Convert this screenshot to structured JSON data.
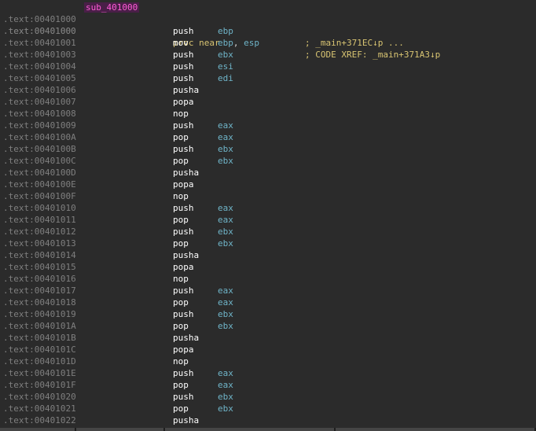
{
  "header": {
    "row1": {
      "address": ".text:00401000",
      "label": "sub_401000",
      "proc": "proc near",
      "comment": "; CODE XREF: _main+371A3↓p"
    },
    "row2": {
      "address": ".text:00401000",
      "comment": "; _main+371EC↓p ..."
    }
  },
  "instructions": [
    {
      "addr": ".text:00401000",
      "mnem": "push",
      "ops": [
        "ebp"
      ]
    },
    {
      "addr": ".text:00401001",
      "mnem": "mov",
      "ops": [
        "ebp",
        "esp"
      ]
    },
    {
      "addr": ".text:00401003",
      "mnem": "push",
      "ops": [
        "ebx"
      ]
    },
    {
      "addr": ".text:00401004",
      "mnem": "push",
      "ops": [
        "esi"
      ]
    },
    {
      "addr": ".text:00401005",
      "mnem": "push",
      "ops": [
        "edi"
      ]
    },
    {
      "addr": ".text:00401006",
      "mnem": "pusha",
      "ops": []
    },
    {
      "addr": ".text:00401007",
      "mnem": "popa",
      "ops": []
    },
    {
      "addr": ".text:00401008",
      "mnem": "nop",
      "ops": []
    },
    {
      "addr": ".text:00401009",
      "mnem": "push",
      "ops": [
        "eax"
      ]
    },
    {
      "addr": ".text:0040100A",
      "mnem": "pop",
      "ops": [
        "eax"
      ]
    },
    {
      "addr": ".text:0040100B",
      "mnem": "push",
      "ops": [
        "ebx"
      ]
    },
    {
      "addr": ".text:0040100C",
      "mnem": "pop",
      "ops": [
        "ebx"
      ]
    },
    {
      "addr": ".text:0040100D",
      "mnem": "pusha",
      "ops": []
    },
    {
      "addr": ".text:0040100E",
      "mnem": "popa",
      "ops": []
    },
    {
      "addr": ".text:0040100F",
      "mnem": "nop",
      "ops": []
    },
    {
      "addr": ".text:00401010",
      "mnem": "push",
      "ops": [
        "eax"
      ]
    },
    {
      "addr": ".text:00401011",
      "mnem": "pop",
      "ops": [
        "eax"
      ]
    },
    {
      "addr": ".text:00401012",
      "mnem": "push",
      "ops": [
        "ebx"
      ]
    },
    {
      "addr": ".text:00401013",
      "mnem": "pop",
      "ops": [
        "ebx"
      ]
    },
    {
      "addr": ".text:00401014",
      "mnem": "pusha",
      "ops": []
    },
    {
      "addr": ".text:00401015",
      "mnem": "popa",
      "ops": []
    },
    {
      "addr": ".text:00401016",
      "mnem": "nop",
      "ops": []
    },
    {
      "addr": ".text:00401017",
      "mnem": "push",
      "ops": [
        "eax"
      ]
    },
    {
      "addr": ".text:00401018",
      "mnem": "pop",
      "ops": [
        "eax"
      ]
    },
    {
      "addr": ".text:00401019",
      "mnem": "push",
      "ops": [
        "ebx"
      ]
    },
    {
      "addr": ".text:0040101A",
      "mnem": "pop",
      "ops": [
        "ebx"
      ]
    },
    {
      "addr": ".text:0040101B",
      "mnem": "pusha",
      "ops": []
    },
    {
      "addr": ".text:0040101C",
      "mnem": "popa",
      "ops": []
    },
    {
      "addr": ".text:0040101D",
      "mnem": "nop",
      "ops": []
    },
    {
      "addr": ".text:0040101E",
      "mnem": "push",
      "ops": [
        "eax"
      ]
    },
    {
      "addr": ".text:0040101F",
      "mnem": "pop",
      "ops": [
        "eax"
      ]
    },
    {
      "addr": ".text:00401020",
      "mnem": "push",
      "ops": [
        "ebx"
      ]
    },
    {
      "addr": ".text:00401021",
      "mnem": "pop",
      "ops": [
        "ebx"
      ]
    },
    {
      "addr": ".text:00401022",
      "mnem": "pusha",
      "ops": []
    }
  ],
  "colors": {
    "background": "#2b2b2b",
    "address": "#7f7f7f",
    "label_text": "#ff5bd7",
    "label_bg": "#4a1f48",
    "keyword": "#d8c472",
    "mnemonic": "#ffffff",
    "register": "#6fb4c8"
  }
}
